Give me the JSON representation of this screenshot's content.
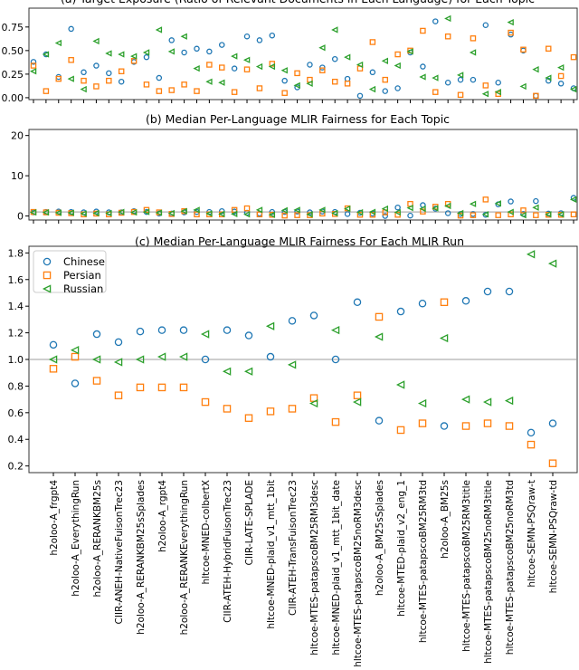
{
  "figure": {
    "legend": {
      "placement": "top-left",
      "entries": [
        {
          "name": "Chinese",
          "marker": "circle",
          "color": "#1f77b4"
        },
        {
          "name": "Persian",
          "marker": "square",
          "color": "#ff7f0e"
        },
        {
          "name": "Russian",
          "marker": "triangle-left",
          "color": "#2ca02c"
        }
      ]
    }
  },
  "chart_data": [
    {
      "type": "scatter",
      "title": "(a) Target Exposure (Ratio of Relevant Documents in Each Language) for Each Topic",
      "xlabel": "",
      "ylabel": "",
      "ylim": [
        -0.02,
        0.95
      ],
      "yticks": [
        0.0,
        0.25,
        0.5,
        0.75
      ],
      "ytick_labels": [
        "0.00",
        "0.25",
        "0.50",
        "0.75"
      ],
      "n_topics": 44,
      "series": [
        {
          "name": "Chinese",
          "values": [
            0.38,
            0.46,
            0.22,
            0.73,
            0.27,
            0.34,
            0.26,
            0.17,
            0.38,
            0.43,
            0.21,
            0.61,
            0.48,
            0.52,
            0.49,
            0.56,
            0.31,
            0.65,
            0.61,
            0.66,
            0.18,
            0.11,
            0.35,
            0.32,
            0.41,
            0.2,
            0.02,
            0.27,
            0.07,
            0.1,
            0.48,
            0.33,
            0.81,
            0.16,
            0.19,
            0.19,
            0.77,
            0.16,
            0.67,
            0.5,
            0.02,
            0.18,
            0.15,
            0.1
          ]
        },
        {
          "name": "Persian",
          "values": [
            0.34,
            0.07,
            0.2,
            0.4,
            0.18,
            0.12,
            0.18,
            0.28,
            0.39,
            0.14,
            0.07,
            0.08,
            0.14,
            0.07,
            0.35,
            0.32,
            0.06,
            0.3,
            0.1,
            0.36,
            0.05,
            0.26,
            0.19,
            0.29,
            0.17,
            0.15,
            0.31,
            0.59,
            0.19,
            0.46,
            0.5,
            0.71,
            0.06,
            0.65,
            0.03,
            0.63,
            0.13,
            0.04,
            0.69,
            0.51,
            0.02,
            0.52,
            0.23,
            0.43
          ]
        },
        {
          "name": "Russian",
          "values": [
            0.28,
            0.46,
            0.58,
            0.2,
            0.09,
            0.6,
            0.47,
            0.46,
            0.44,
            0.48,
            0.72,
            0.49,
            0.65,
            0.31,
            0.17,
            0.16,
            0.44,
            0.4,
            0.33,
            0.33,
            0.29,
            0.13,
            0.15,
            0.53,
            0.72,
            0.43,
            0.35,
            0.09,
            0.39,
            0.34,
            0.49,
            0.22,
            0.21,
            0.84,
            0.24,
            0.48,
            0.04,
            0.06,
            0.8,
            0.12,
            0.3,
            0.21,
            0.32,
            0.09
          ]
        }
      ]
    },
    {
      "type": "scatter",
      "title": "(b) Median Per-Language MLIR Fairness for Each Topic",
      "xlabel": "",
      "ylabel": "",
      "ylim": [
        -1,
        21.5
      ],
      "yticks": [
        0,
        10,
        20
      ],
      "ytick_labels": [
        "0",
        "10",
        "20"
      ],
      "reference_line": 1.0,
      "n_topics": 44,
      "series": [
        {
          "name": "Chinese",
          "values": [
            0.9,
            1.0,
            1.1,
            1.0,
            0.9,
            1.1,
            0.9,
            0.9,
            1.2,
            1.0,
            0.6,
            0.6,
            0.9,
            1.0,
            1.0,
            1.2,
            1.1,
            0.8,
            0.6,
            1.0,
            1.0,
            1.1,
            0.9,
            1.1,
            1.0,
            0.5,
            0.8,
            0.6,
            0.0,
            2.1,
            0.1,
            2.7,
            1.8,
            0.7,
            0.5,
            0.5,
            0.3,
            2.9,
            3.6,
            0.5,
            3.7,
            0.6,
            0.7,
            4.5
          ]
        },
        {
          "name": "Persian",
          "values": [
            1.0,
            0.9,
            0.8,
            0.7,
            0.4,
            0.6,
            0.4,
            0.8,
            1.0,
            1.5,
            0.9,
            0.5,
            1.2,
            0.4,
            0.4,
            0.4,
            1.5,
            1.9,
            0.4,
            0.3,
            0.1,
            0.2,
            0.2,
            0.6,
            0.5,
            1.9,
            0.3,
            0.3,
            0.9,
            0.3,
            3.0,
            1.1,
            2.3,
            3.0,
            0.1,
            0.2,
            4.1,
            0.2,
            0.4,
            1.4,
            0.2,
            0.3,
            0.3,
            0.4
          ]
        },
        {
          "name": "Russian",
          "values": [
            0.9,
            0.9,
            0.8,
            0.8,
            0.6,
            0.7,
            0.7,
            1.0,
            0.9,
            1.0,
            0.8,
            0.7,
            1.2,
            1.5,
            0.6,
            0.5,
            0.5,
            0.4,
            1.5,
            0.3,
            1.4,
            1.5,
            0.4,
            1.5,
            0.7,
            1.8,
            0.9,
            1.0,
            1.8,
            0.9,
            2.0,
            1.8,
            1.9,
            2.5,
            0.7,
            3.0,
            0.4,
            3.1,
            1.0,
            0.2,
            2.1,
            0.4,
            0.4,
            4.1
          ]
        }
      ]
    },
    {
      "type": "scatter",
      "title": "(c) Median Per-Language MLIR Fairness For Each MLIR Run",
      "xlabel": "",
      "ylabel": "",
      "ylim": [
        0.15,
        1.85
      ],
      "yticks": [
        0.2,
        0.4,
        0.6,
        0.8,
        1.0,
        1.2,
        1.4,
        1.6,
        1.8
      ],
      "ytick_labels": [
        "0.2",
        "0.4",
        "0.6",
        "0.8",
        "1.0",
        "1.2",
        "1.4",
        "1.6",
        "1.8"
      ],
      "reference_line": 1.0,
      "categories": [
        "h2oloo-A_frgpt4",
        "h2oloo-A_EverythingRun",
        "h2oloo-A_RERANKBM25s",
        "CIIR-ANEH-NativeFuisonTrec23",
        "h2oloo-A_RERANKBM25sSplades",
        "h2oloo-A_rgpt4",
        "h2oloo-A_RERANKEverythingRun",
        "hltcoe-MNED-colbertX",
        "CIIR-ATEH-HybridFuisonTrec23",
        "CIIR-LATE-SPLADE",
        "hltcoe-MNED-plaid_v1_mtt_1bit",
        "CIIR-ATEH-TransFuisonTrec23",
        "hltcoe-MTES-patapscoBM25RM3desc",
        "hltcoe-MNED-plaid_v1_mtt_1bit_date",
        "hltcoe-MTES-patapscoBM25noRM3desc",
        "h2oloo-A_BM25sSplades",
        "hltcoe-MTED-plaid_v2_eng_1",
        "hltcoe-MTES-patapscoBM25RM3td",
        "h2oloo-A_BM25s",
        "hltcoe-MTES-patapscoBM25RM3title",
        "hltcoe-MTES-patapscoBM25noRM3title",
        "hltcoe-MTES-patapscoBM25noRM3td",
        "hltcoe-SEMN-PSQraw-t",
        "hltcoe-SEMN-PSQraw-td"
      ],
      "series": [
        {
          "name": "Chinese",
          "values": [
            1.11,
            0.82,
            1.19,
            1.13,
            1.21,
            1.22,
            1.22,
            1.0,
            1.22,
            1.18,
            1.02,
            1.29,
            1.33,
            1.0,
            1.43,
            0.54,
            1.36,
            1.42,
            0.5,
            1.44,
            1.51,
            1.51,
            0.45,
            0.52
          ]
        },
        {
          "name": "Persian",
          "values": [
            0.93,
            1.02,
            0.84,
            0.73,
            0.79,
            0.79,
            0.79,
            0.68,
            0.63,
            0.56,
            0.61,
            0.63,
            0.71,
            0.53,
            0.73,
            1.32,
            0.47,
            0.52,
            1.43,
            0.5,
            0.52,
            0.5,
            0.36,
            0.22
          ]
        },
        {
          "name": "Russian",
          "values": [
            1.0,
            1.07,
            1.0,
            0.98,
            1.0,
            1.02,
            1.02,
            1.19,
            0.91,
            0.91,
            1.25,
            0.96,
            0.67,
            1.22,
            0.68,
            1.17,
            0.81,
            0.67,
            1.16,
            0.7,
            0.68,
            0.69,
            1.79,
            1.72
          ]
        }
      ]
    }
  ]
}
